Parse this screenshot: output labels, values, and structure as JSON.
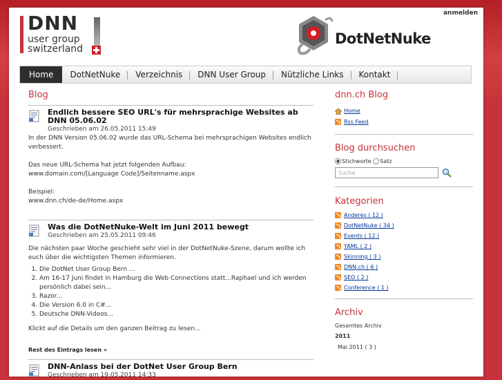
{
  "header": {
    "login_label": "anmelden",
    "logo": {
      "big": "DNN",
      "line1": "user group",
      "line2": "switzerland"
    },
    "brand_logo_text": "DotNetNuke"
  },
  "nav": {
    "items": [
      {
        "label": "Home",
        "active": true
      },
      {
        "label": "DotNetNuke"
      },
      {
        "label": "Verzeichnis"
      },
      {
        "label": "DNN User Group"
      },
      {
        "label": "Nützliche Links"
      },
      {
        "label": "Kontakt"
      }
    ]
  },
  "main": {
    "title": "Blog",
    "posts": [
      {
        "title": "Endlich bessere SEO URL's für mehrsprachige Websites ab DNN 05.06.02",
        "meta": "Geschrieben am 26.05.2011 15:49",
        "p1": "In der DNN Version 05.06.02 wurde das URL-Schema bei mehrsprachigen Websites endlich verbessert.",
        "p2a": "Das neue URL-Schema hat jetzt folgenden Aufbau:",
        "p2b": "www.domain.com/[Language Code]/Seitenname.aspx",
        "p3a": "Beispiel:",
        "p3b": "www.dnn.ch/de-de/Home.aspx"
      },
      {
        "title": "Was die DotNetNuke-Welt im Juni 2011 bewegt",
        "meta": "Geschrieben am 25.05.2011 09:46",
        "intro": "Die nächsten paar Woche geschieht sehr viel in der DotNetNuke-Szene, darum wollte ich euch über die wichtigsten Themen informieren.",
        "list": [
          "Die DotNet User Group Bern ...",
          "Am 16-17 Juni findet in Hamburg die Web Connections statt...Raphael und ich werden persönlich dabei sein...",
          "Razor...",
          "Die Version 6.0 in C#...",
          "Deutsche DNN-Videos..."
        ],
        "outro": "Klickt auf die Details um den ganzen Beitrag zu lesen...",
        "more": "Rest des Eintrags lesen »"
      },
      {
        "title": "DNN-Anlass bei der DotNet User Group Bern",
        "meta": "Geschrieben am 19.05.2011 14:33"
      }
    ]
  },
  "sidebar": {
    "blog_title": "dnn.ch Blog",
    "home_link": "Home",
    "rss_link": "Rss Feed",
    "search_title": "Blog durchsuchen",
    "radio1": "Stichworte",
    "radio2": "Satz",
    "search_placeholder": "Suche",
    "cat_title": "Kategorien",
    "categories": [
      "Anderes ( 12 )",
      "DotNetNuke ( 34 )",
      "Events ( 12 )",
      "YAML ( 2 )",
      "Skinning ( 3 )",
      "DNN.ch ( 6 )",
      "SEO ( 2 )",
      "Conference ( 1 )"
    ],
    "archive_title": "Archiv",
    "archive_all": "Gesamtes Archiv",
    "archive_year": "2011",
    "archive_month": "Mai 2011 ( 3 )"
  },
  "colors": {
    "accent": "#c8323a",
    "nav_active": "#2d2d2d"
  }
}
